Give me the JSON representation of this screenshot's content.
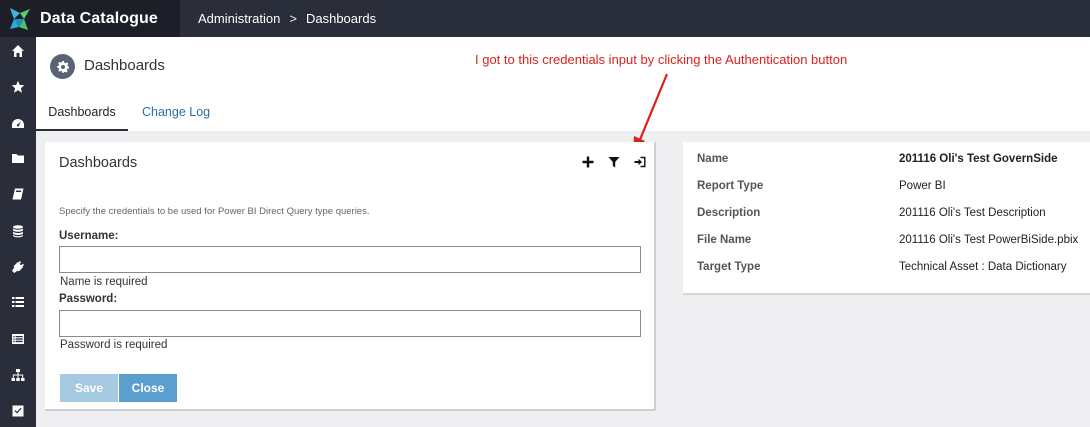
{
  "brand": {
    "name": "Data Catalogue"
  },
  "breadcrumb": {
    "items": [
      "Administration",
      "Dashboards"
    ],
    "separator": ">"
  },
  "sidebar": {
    "icons": [
      "home-icon",
      "star-icon",
      "dashboard-gauge-icon",
      "folder-icon",
      "book-icon",
      "database-icon",
      "plug-icon",
      "list-icon",
      "list-alt-icon",
      "sitemap-icon",
      "checkbox-icon"
    ]
  },
  "header": {
    "title": "Dashboards"
  },
  "tabs": [
    {
      "label": "Dashboards",
      "active": true
    },
    {
      "label": "Change Log",
      "active": false
    }
  ],
  "annotation": {
    "text": "I got to this credentials input by clicking the Authentication button",
    "color": "#d9221d"
  },
  "form": {
    "title": "Dashboards",
    "toolbar": [
      "add-icon",
      "filter-icon",
      "sign-in-icon"
    ],
    "hint": "Specify the credentials to be used for Power BI Direct Query type queries.",
    "username": {
      "label": "Username:",
      "value": "",
      "error": "Name is required"
    },
    "password": {
      "label": "Password:",
      "value": "",
      "error": "Password is required"
    },
    "save_label": "Save",
    "close_label": "Close"
  },
  "details": {
    "rows": [
      {
        "label": "Name",
        "value": "201116 Oli's Test GovernSide"
      },
      {
        "label": "Report Type",
        "value": "Power BI"
      },
      {
        "label": "Description",
        "value": "201116 Oli's Test Description"
      },
      {
        "label": "File Name",
        "value": "201116 Oli's Test PowerBiSide.pbix"
      },
      {
        "label": "Target Type",
        "value": "Technical Asset : Data Dictionary"
      }
    ]
  },
  "colors": {
    "nav": "#2a2e3b",
    "accent": "#5b9fcf",
    "link": "#2c6ea3"
  }
}
